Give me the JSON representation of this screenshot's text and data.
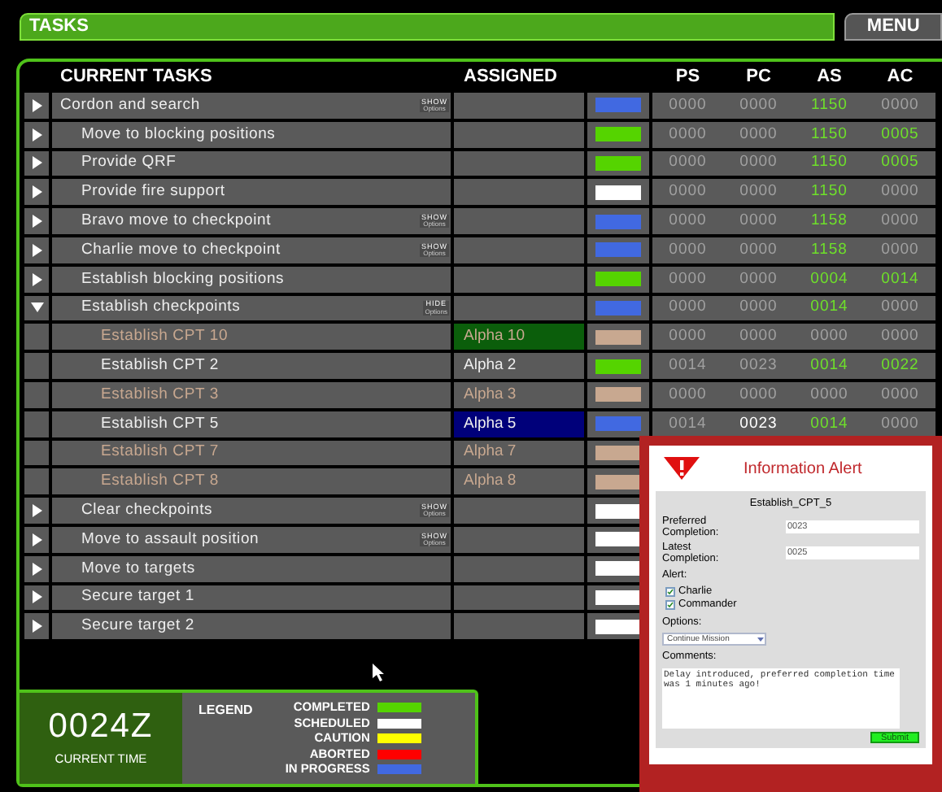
{
  "title": "TASKS",
  "menu_button": "MENU",
  "columns": {
    "task": "CURRENT TASKS",
    "assigned": "ASSIGNED",
    "numbers": [
      "PS",
      "PC",
      "AS",
      "AC"
    ]
  },
  "tasks": [
    {
      "name": "Cordon and search",
      "expanded": false,
      "options": {
        "action": "SHOW",
        "label": "Options"
      },
      "color": "#4169e1",
      "numbers": [
        {
          "value": "0000",
          "kind": "dim"
        },
        {
          "value": "0000",
          "kind": "dim"
        },
        {
          "value": "1150",
          "kind": "actual"
        },
        {
          "value": "0000",
          "kind": "dim"
        }
      ],
      "children": [
        {
          "name": "Move to blocking positions",
          "expanded": false,
          "color": "#55d400",
          "numbers": [
            {
              "value": "0000",
              "kind": "dim"
            },
            {
              "value": "0000",
              "kind": "dim"
            },
            {
              "value": "1150",
              "kind": "actual"
            },
            {
              "value": "0005",
              "kind": "actual"
            }
          ]
        },
        {
          "name": "Provide QRF",
          "expanded": false,
          "color": "#55d400",
          "numbers": [
            {
              "value": "0000",
              "kind": "dim"
            },
            {
              "value": "0000",
              "kind": "dim"
            },
            {
              "value": "1150",
              "kind": "actual"
            },
            {
              "value": "0005",
              "kind": "actual"
            }
          ]
        },
        {
          "name": "Provide fire support",
          "expanded": false,
          "color": "#ffffff",
          "numbers": [
            {
              "value": "0000",
              "kind": "dim"
            },
            {
              "value": "0000",
              "kind": "dim"
            },
            {
              "value": "1150",
              "kind": "actual"
            },
            {
              "value": "0000",
              "kind": "dim"
            }
          ]
        },
        {
          "name": "Bravo move to checkpoint",
          "expanded": false,
          "options": {
            "action": "SHOW",
            "label": "Options"
          },
          "color": "#4169e1",
          "numbers": [
            {
              "value": "0000",
              "kind": "dim"
            },
            {
              "value": "0000",
              "kind": "dim"
            },
            {
              "value": "1158",
              "kind": "actual"
            },
            {
              "value": "0000",
              "kind": "dim"
            }
          ]
        },
        {
          "name": "Charlie move to checkpoint",
          "expanded": false,
          "options": {
            "action": "SHOW",
            "label": "Options"
          },
          "color": "#4169e1",
          "numbers": [
            {
              "value": "0000",
              "kind": "dim"
            },
            {
              "value": "0000",
              "kind": "dim"
            },
            {
              "value": "1158",
              "kind": "actual"
            },
            {
              "value": "0000",
              "kind": "dim"
            }
          ]
        },
        {
          "name": "Establish blocking positions",
          "expanded": false,
          "color": "#55d400",
          "numbers": [
            {
              "value": "0000",
              "kind": "dim"
            },
            {
              "value": "0000",
              "kind": "dim"
            },
            {
              "value": "0004",
              "kind": "actual"
            },
            {
              "value": "0014",
              "kind": "actual"
            }
          ]
        },
        {
          "name": "Establish checkpoints",
          "expanded": true,
          "options": {
            "action": "HIDE",
            "label": "Options"
          },
          "color": "#4169e1",
          "numbers": [
            {
              "value": "0000",
              "kind": "dim"
            },
            {
              "value": "0000",
              "kind": "dim"
            },
            {
              "value": "0014",
              "kind": "actual"
            },
            {
              "value": "0000",
              "kind": "dim"
            }
          ],
          "children": [
            {
              "name": "Establish CPT 10",
              "dimmed": true,
              "assigned": {
                "text": "Alpha 10",
                "color": "#0b5e0b"
              },
              "color": "#c8a890",
              "numbers": [
                {
                  "value": "0000",
                  "kind": "dim"
                },
                {
                  "value": "0000",
                  "kind": "dim"
                },
                {
                  "value": "0000",
                  "kind": "dim"
                },
                {
                  "value": "0000",
                  "kind": "dim"
                }
              ]
            },
            {
              "name": "Establish CPT 2",
              "dimmed": false,
              "assigned": {
                "text": "Alpha 2"
              },
              "color": "#55d400",
              "numbers": [
                {
                  "value": "0014",
                  "kind": "dim"
                },
                {
                  "value": "0023",
                  "kind": "dim"
                },
                {
                  "value": "0014",
                  "kind": "actual"
                },
                {
                  "value": "0022",
                  "kind": "actual"
                }
              ]
            },
            {
              "name": "Establish CPT 3",
              "dimmed": true,
              "assigned": {
                "text": "Alpha 3"
              },
              "color": "#c8a890",
              "numbers": [
                {
                  "value": "0000",
                  "kind": "dim"
                },
                {
                  "value": "0000",
                  "kind": "dim"
                },
                {
                  "value": "0000",
                  "kind": "dim"
                },
                {
                  "value": "0000",
                  "kind": "dim"
                }
              ]
            },
            {
              "name": "Establish CPT 5",
              "dimmed": false,
              "assigned": {
                "text": "Alpha 5",
                "color": "#00007a"
              },
              "color": "#4169e1",
              "numbers": [
                {
                  "value": "0014",
                  "kind": "dim"
                },
                {
                  "value": "0023",
                  "kind": "alert"
                },
                {
                  "value": "0014",
                  "kind": "actual"
                },
                {
                  "value": "0000",
                  "kind": "dim"
                }
              ]
            },
            {
              "name": "Establish CPT 7",
              "dimmed": true,
              "assigned": {
                "text": "Alpha 7"
              },
              "color": "#c8a890"
            },
            {
              "name": "Establish CPT 8",
              "dimmed": true,
              "assigned": {
                "text": "Alpha 8"
              },
              "color": "#c8a890"
            }
          ]
        },
        {
          "name": "Clear checkpoints",
          "expanded": false,
          "options": {
            "action": "SHOW",
            "label": "Options"
          },
          "color": "#ffffff"
        },
        {
          "name": "Move to assault position",
          "expanded": false,
          "options": {
            "action": "SHOW",
            "label": "Options"
          },
          "color": "#ffffff"
        },
        {
          "name": "Move to targets",
          "expanded": false,
          "color": "#ffffff"
        },
        {
          "name": "Secure target 1",
          "expanded": false,
          "color": "#ffffff"
        },
        {
          "name": "Secure target 2",
          "expanded": false,
          "color": "#ffffff"
        }
      ]
    }
  ],
  "clock": {
    "time": "0024Z",
    "label": "CURRENT TIME"
  },
  "legend": {
    "title": "LEGEND",
    "items": [
      {
        "label": "COMPLETED",
        "color": "#55d400"
      },
      {
        "label": "SCHEDULED",
        "color": "#ffffff"
      },
      {
        "label": "CAUTION",
        "color": "#ffff00"
      },
      {
        "label": "ABORTED",
        "color": "#ff0000"
      },
      {
        "label": "IN PROGRESS",
        "color": "#4169e1"
      }
    ]
  },
  "alert": {
    "title": "Information Alert",
    "task": "Establish_CPT_5",
    "preferred": {
      "label": "Preferred Completion:",
      "value": "0023"
    },
    "latest": {
      "label": "Latest Completion:",
      "value": "0025"
    },
    "alert_label": "Alert:",
    "recipients": [
      {
        "label": "Charlie",
        "checked": true
      },
      {
        "label": "Commander",
        "checked": true
      }
    ],
    "options_label": "Options:",
    "option_value": "Continue Mission",
    "comments_label": "Comments:",
    "comments": "Delay introduced, preferred completion time was 1 minutes ago!",
    "submit": "Submit"
  }
}
